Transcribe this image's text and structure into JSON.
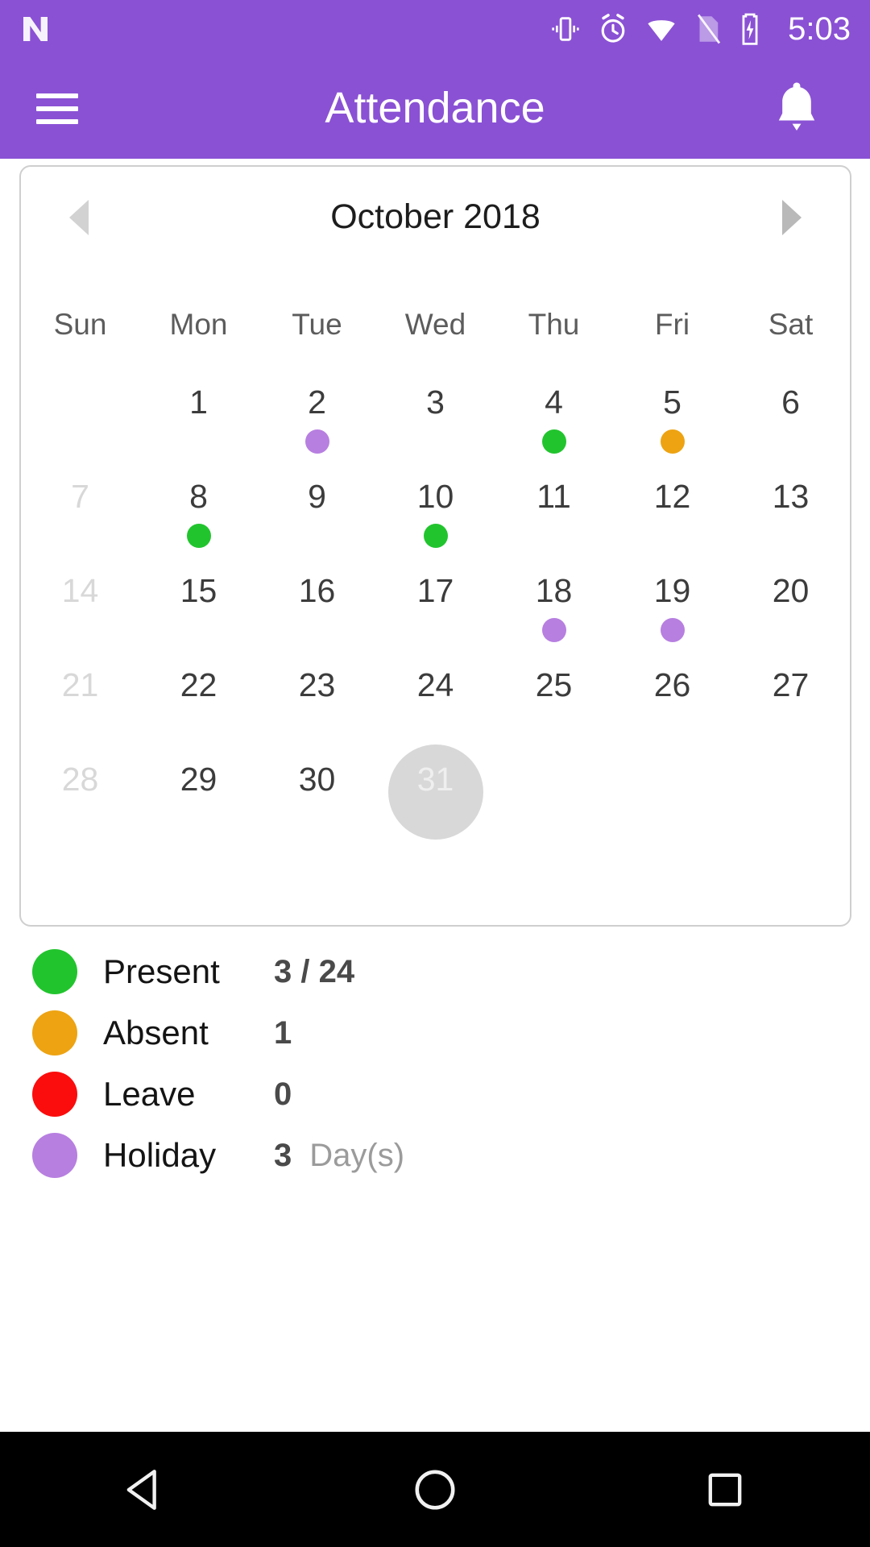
{
  "statusbar": {
    "time": "5:03",
    "icons": [
      "android-n-logo",
      "vibrate-icon",
      "alarm-icon",
      "wifi-icon",
      "sim-card-icon",
      "battery-charging-icon"
    ]
  },
  "appbar": {
    "title": "Attendance",
    "menu_icon": "hamburger-menu-icon",
    "notification_icon": "bell-icon"
  },
  "calendar": {
    "month_title": "October 2018",
    "prev_icon": "triangle-left-icon",
    "next_icon": "triangle-right-icon",
    "weekdays": [
      "Sun",
      "Mon",
      "Tue",
      "Wed",
      "Thu",
      "Fri",
      "Sat"
    ],
    "weeks": [
      [
        {
          "num": "",
          "state": "empty",
          "dot": ""
        },
        {
          "num": "1",
          "state": "normal",
          "dot": ""
        },
        {
          "num": "2",
          "state": "normal",
          "dot": "holiday"
        },
        {
          "num": "3",
          "state": "normal",
          "dot": ""
        },
        {
          "num": "4",
          "state": "normal",
          "dot": "present"
        },
        {
          "num": "5",
          "state": "normal",
          "dot": "absent"
        },
        {
          "num": "6",
          "state": "normal",
          "dot": ""
        }
      ],
      [
        {
          "num": "7",
          "state": "dim",
          "dot": ""
        },
        {
          "num": "8",
          "state": "normal",
          "dot": "present"
        },
        {
          "num": "9",
          "state": "normal",
          "dot": ""
        },
        {
          "num": "10",
          "state": "normal",
          "dot": "present"
        },
        {
          "num": "11",
          "state": "normal",
          "dot": ""
        },
        {
          "num": "12",
          "state": "normal",
          "dot": ""
        },
        {
          "num": "13",
          "state": "normal",
          "dot": ""
        }
      ],
      [
        {
          "num": "14",
          "state": "dim",
          "dot": ""
        },
        {
          "num": "15",
          "state": "normal",
          "dot": ""
        },
        {
          "num": "16",
          "state": "normal",
          "dot": ""
        },
        {
          "num": "17",
          "state": "normal",
          "dot": ""
        },
        {
          "num": "18",
          "state": "normal",
          "dot": "holiday"
        },
        {
          "num": "19",
          "state": "normal",
          "dot": "holiday"
        },
        {
          "num": "20",
          "state": "normal",
          "dot": ""
        }
      ],
      [
        {
          "num": "21",
          "state": "dim",
          "dot": ""
        },
        {
          "num": "22",
          "state": "normal",
          "dot": ""
        },
        {
          "num": "23",
          "state": "normal",
          "dot": ""
        },
        {
          "num": "24",
          "state": "normal",
          "dot": ""
        },
        {
          "num": "25",
          "state": "normal",
          "dot": ""
        },
        {
          "num": "26",
          "state": "normal",
          "dot": ""
        },
        {
          "num": "27",
          "state": "normal",
          "dot": ""
        }
      ],
      [
        {
          "num": "28",
          "state": "dim",
          "dot": ""
        },
        {
          "num": "29",
          "state": "normal",
          "dot": ""
        },
        {
          "num": "30",
          "state": "normal",
          "dot": ""
        },
        {
          "num": "31",
          "state": "today",
          "dot": ""
        },
        {
          "num": "",
          "state": "empty",
          "dot": ""
        },
        {
          "num": "",
          "state": "empty",
          "dot": ""
        },
        {
          "num": "",
          "state": "empty",
          "dot": ""
        }
      ]
    ]
  },
  "legend": [
    {
      "label": "Present",
      "value": "3 / 24",
      "unit": "",
      "color": "#22c42e"
    },
    {
      "label": "Absent",
      "value": "1",
      "unit": "",
      "color": "#eda312"
    },
    {
      "label": "Leave",
      "value": "0",
      "unit": "",
      "color": "#fb0d0d"
    },
    {
      "label": "Holiday",
      "value": "3",
      "unit": "Day(s)",
      "color": "#b77fe0"
    }
  ],
  "navbar": {
    "back_icon": "back-triangle-icon",
    "home_icon": "home-circle-icon",
    "recents_icon": "recents-square-icon"
  },
  "colors": {
    "accent_purple": "#8a51d4",
    "present_green": "#22c42e",
    "absent_orange": "#eda312",
    "leave_red": "#fb0d0d",
    "holiday_purple": "#b77fe0",
    "today_gray": "#d8d8d8"
  }
}
